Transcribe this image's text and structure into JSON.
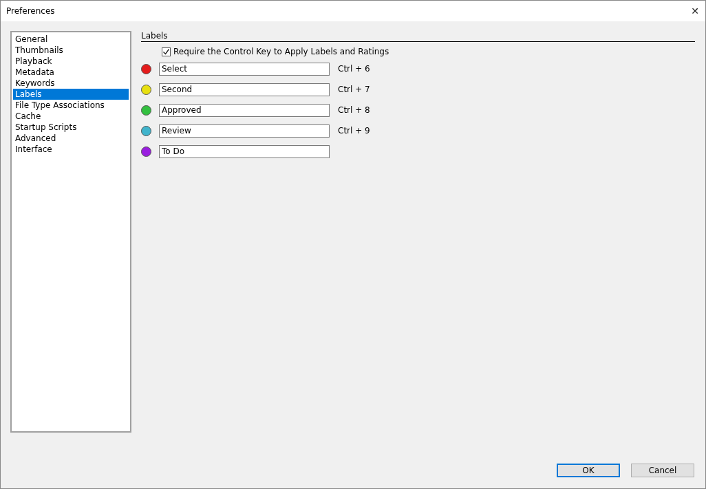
{
  "window": {
    "title": "Preferences",
    "close": "✕"
  },
  "sidebar": {
    "items": [
      {
        "label": "General",
        "selected": false
      },
      {
        "label": "Thumbnails",
        "selected": false
      },
      {
        "label": "Playback",
        "selected": false
      },
      {
        "label": "Metadata",
        "selected": false
      },
      {
        "label": "Keywords",
        "selected": false
      },
      {
        "label": "Labels",
        "selected": true
      },
      {
        "label": "File Type Associations",
        "selected": false
      },
      {
        "label": "Cache",
        "selected": false
      },
      {
        "label": "Startup Scripts",
        "selected": false
      },
      {
        "label": "Advanced",
        "selected": false
      },
      {
        "label": "Interface",
        "selected": false
      }
    ]
  },
  "section": {
    "title": "Labels",
    "require_control_key": {
      "label": "Require the Control Key to Apply Labels and Ratings",
      "checked": true
    },
    "labels": [
      {
        "color": "#e51c1c",
        "value": "Select",
        "shortcut": "Ctrl + 6"
      },
      {
        "color": "#e8e010",
        "value": "Second",
        "shortcut": "Ctrl + 7"
      },
      {
        "color": "#33c040",
        "value": "Approved",
        "shortcut": "Ctrl + 8"
      },
      {
        "color": "#40b4cc",
        "value": "Review",
        "shortcut": "Ctrl + 9"
      },
      {
        "color": "#9a1ee0",
        "value": "To Do"
      }
    ]
  },
  "buttons": [
    {
      "label": "OK",
      "default": true
    },
    {
      "label": "Cancel",
      "default": false
    }
  ]
}
